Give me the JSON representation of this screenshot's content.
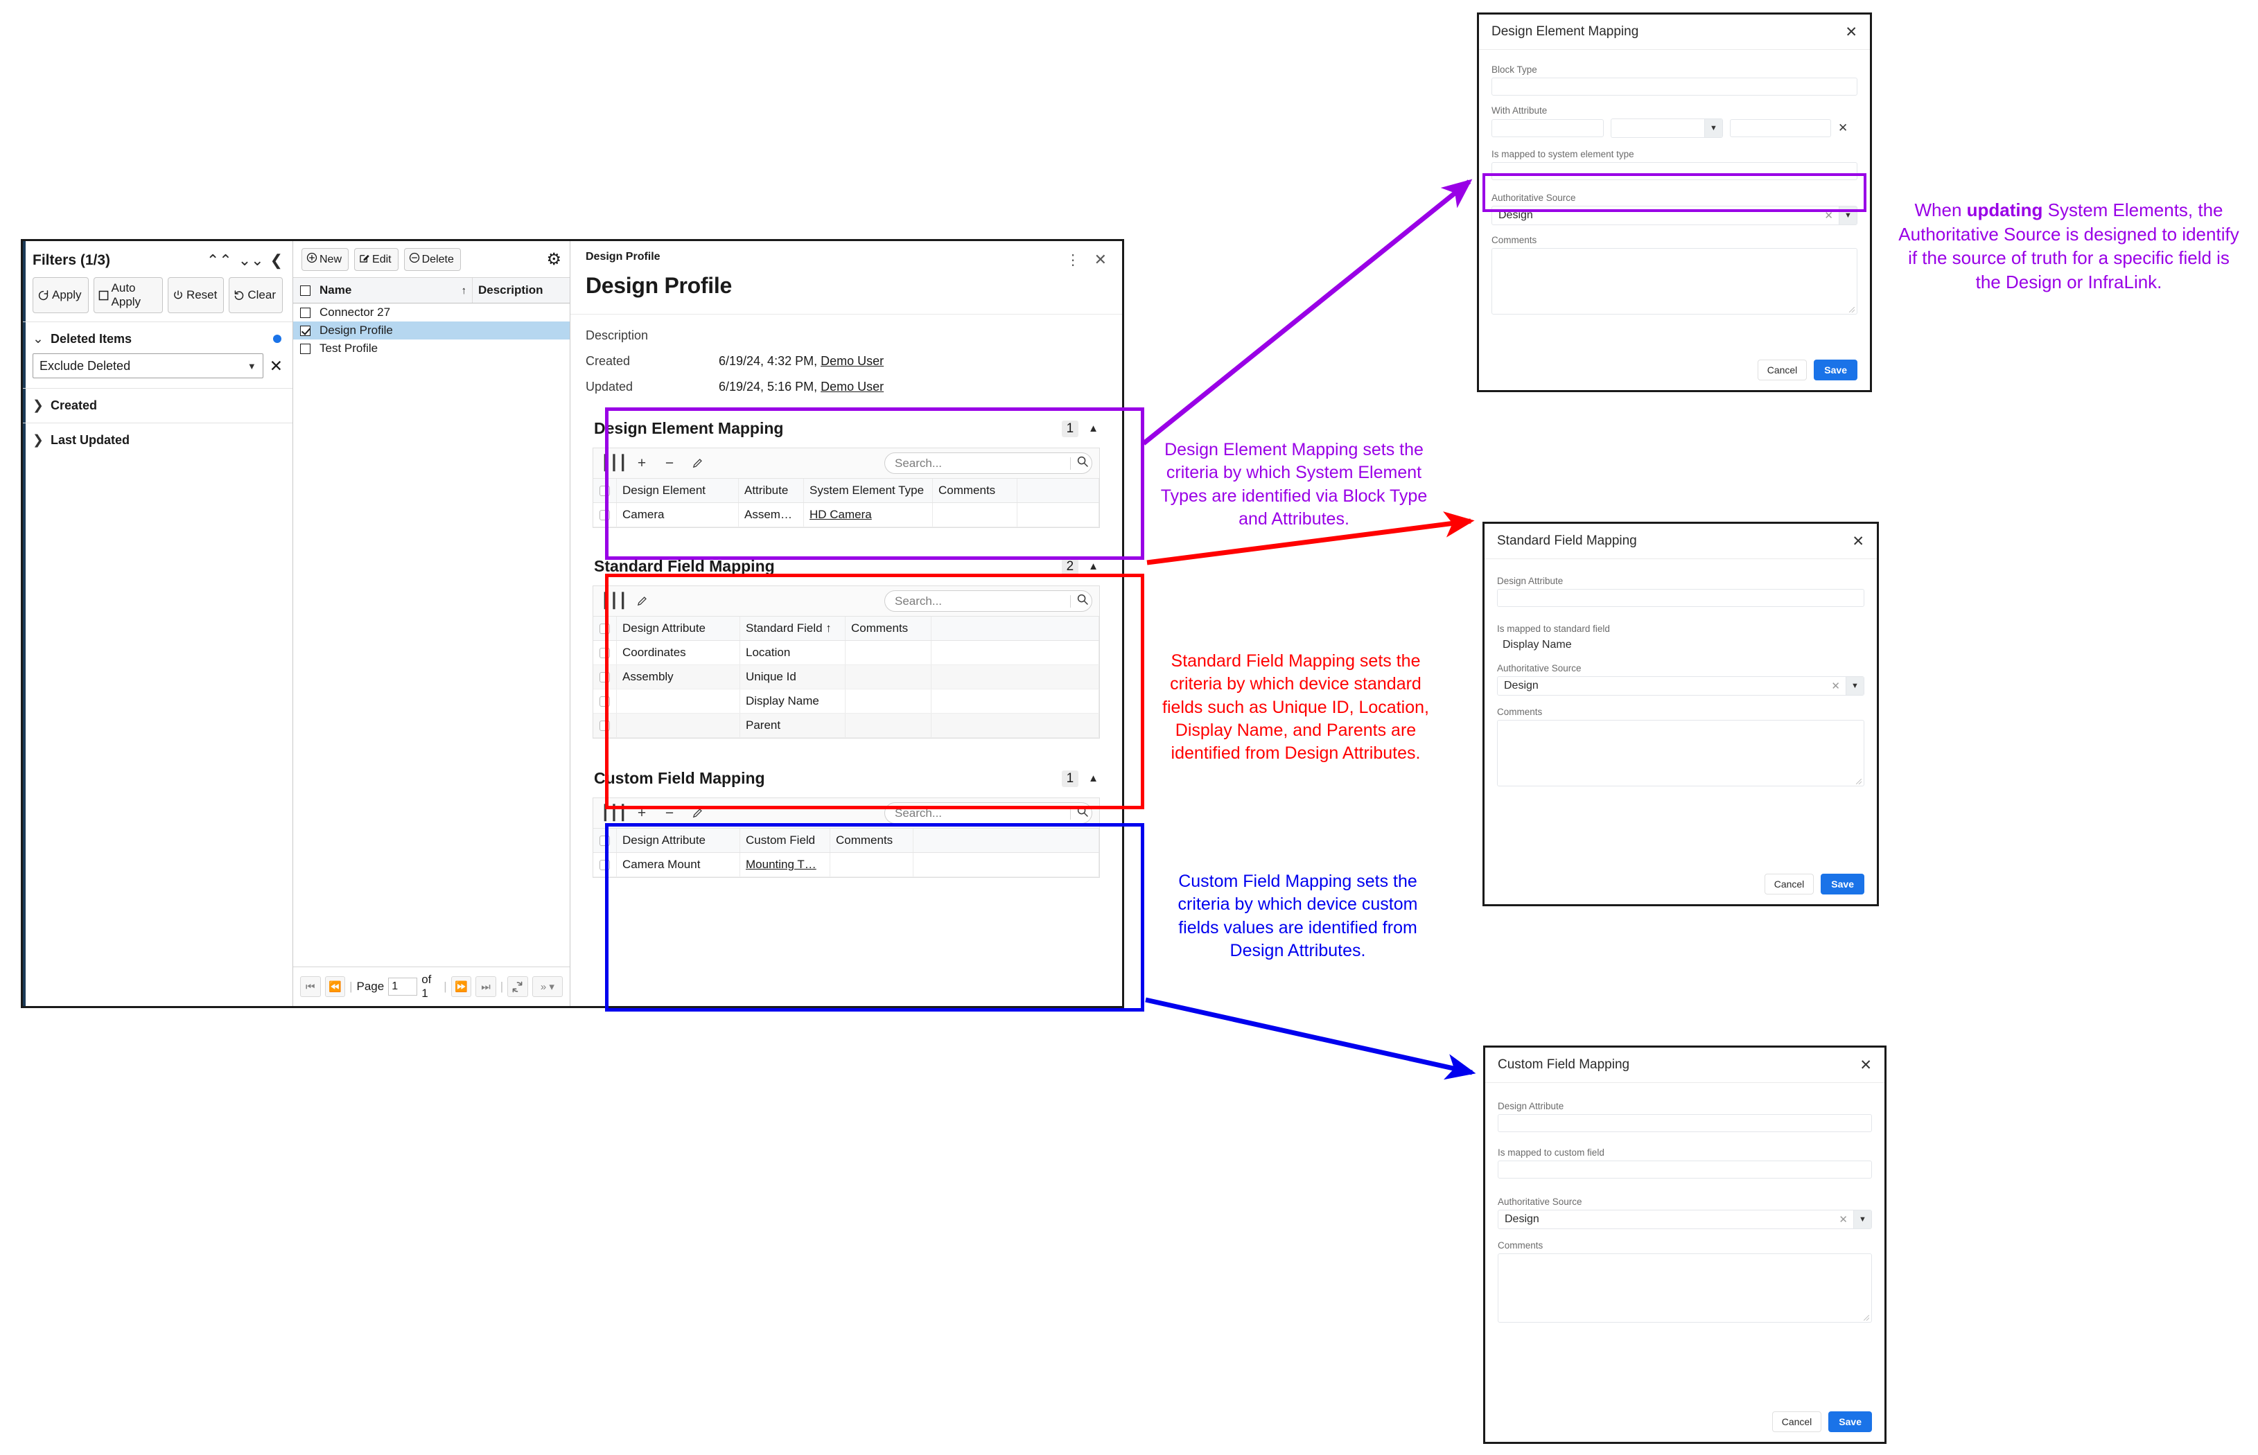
{
  "filters": {
    "title": "Filters (1/3)",
    "collapse_all_icon": "chevrons-up-icon",
    "expand_all_icon": "chevrons-down-icon",
    "hide_panel_icon": "chevron-left-icon",
    "buttons": [
      {
        "label": "Apply",
        "icon": "refresh-icon"
      },
      {
        "label": "Auto Apply",
        "icon": "checkbox-icon"
      },
      {
        "label": "Reset",
        "icon": "power-icon"
      },
      {
        "label": "Clear",
        "icon": "undo-icon"
      }
    ],
    "sections": [
      {
        "label": "Deleted Items",
        "expanded": true,
        "has_dot": true,
        "value": "Exclude Deleted"
      },
      {
        "label": "Created",
        "expanded": false,
        "has_dot": false
      },
      {
        "label": "Last Updated",
        "expanded": false,
        "has_dot": false
      }
    ]
  },
  "list": {
    "toolbar": [
      {
        "label": "New",
        "icon": "plus-circle-icon"
      },
      {
        "label": "Edit",
        "icon": "pencil-square-icon"
      },
      {
        "label": "Delete",
        "icon": "minus-circle-icon"
      }
    ],
    "settings_icon": "gear-icon",
    "columns": [
      "Name",
      "Description"
    ],
    "sort_arrow": "↑",
    "rows": [
      {
        "name": "Connector 27",
        "description": "",
        "checked": false,
        "selected": false
      },
      {
        "name": "Design Profile",
        "description": "",
        "checked": true,
        "selected": true
      },
      {
        "name": "Test Profile",
        "description": "",
        "checked": false,
        "selected": false
      }
    ],
    "pager": {
      "first_icon": "first-page-icon",
      "prev_icon": "prev-page-icon",
      "page_label": "Page",
      "page_value": "1",
      "of_label": "of 1",
      "next_icon": "next-page-icon",
      "last_icon": "last-page-icon",
      "refresh_icon": "refresh-icon",
      "more_icon": "double-chevron-right-icon"
    }
  },
  "detail": {
    "breadcrumb": "Design Profile",
    "menu_icon": "more-vertical-icon",
    "close_icon": "close-icon",
    "title": "Design Profile",
    "meta": [
      {
        "key": "Description",
        "value": "",
        "user": ""
      },
      {
        "key": "Created",
        "value": "6/19/24, 4:32 PM,",
        "user": "Demo User"
      },
      {
        "key": "Updated",
        "value": "6/19/24, 5:16 PM,",
        "user": "Demo User"
      }
    ]
  },
  "sections": [
    {
      "id": "design-element-mapping",
      "title": "Design Element Mapping",
      "count": "1",
      "collapse_icon": "caret-up-icon",
      "tools": [
        "columns-icon",
        "plus-icon",
        "minus-icon",
        "pencil-icon"
      ],
      "search_placeholder": "Search...",
      "search_icon": "search-icon",
      "columns": [
        "Design Element",
        "Attribute",
        "System Element Type",
        "Comments"
      ],
      "rows": [
        {
          "cells": [
            "Camera",
            "Assem…",
            "HD Camera",
            ""
          ],
          "link_index": 2
        }
      ],
      "outline_color": "#9900e6"
    },
    {
      "id": "standard-field-mapping",
      "title": "Standard Field Mapping",
      "count": "2",
      "collapse_icon": "caret-up-icon",
      "tools": [
        "columns-icon",
        "pencil-icon"
      ],
      "search_placeholder": "Search...",
      "search_icon": "search-icon",
      "columns": [
        "Design Attribute",
        "Standard Field ↑",
        "Comments"
      ],
      "rows": [
        {
          "cells": [
            "Coordinates",
            "Location",
            ""
          ],
          "link_index": -1
        },
        {
          "cells": [
            "Assembly",
            "Unique Id",
            ""
          ],
          "link_index": -1
        },
        {
          "cells": [
            "",
            "Display Name",
            ""
          ],
          "link_index": -1
        },
        {
          "cells": [
            "",
            "Parent",
            ""
          ],
          "link_index": -1
        }
      ],
      "outline_color": "#ff0000"
    },
    {
      "id": "custom-field-mapping",
      "title": "Custom Field Mapping",
      "count": "1",
      "collapse_icon": "caret-up-icon",
      "tools": [
        "columns-icon",
        "plus-icon",
        "minus-icon",
        "pencil-icon"
      ],
      "search_placeholder": "Search...",
      "search_icon": "search-icon",
      "columns": [
        "Design Attribute",
        "Custom Field",
        "Comments"
      ],
      "rows": [
        {
          "cells": [
            "Camera Mount",
            "Mounting T…",
            ""
          ],
          "link_index": 1
        }
      ],
      "outline_color": "#0000ee"
    }
  ],
  "dialogs": {
    "design_element": {
      "title": "Design Element Mapping",
      "close_icon": "close-icon",
      "block_type_label": "Block Type",
      "block_type_value": "",
      "with_attribute_label": "With Attribute",
      "with_attribute_value_1": "",
      "with_attribute_operator": "",
      "with_attribute_value_2": "",
      "remove_icon": "close-icon",
      "mapped_label": "Is mapped to system element type",
      "mapped_value": "",
      "auth_label": "Authoritative Source",
      "auth_value": "Design",
      "clear_icon": "close-icon",
      "dropdown_icon": "caret-down-icon",
      "comments_label": "Comments",
      "comments_value": "",
      "cancel_label": "Cancel",
      "save_label": "Save"
    },
    "standard_field": {
      "title": "Standard Field Mapping",
      "close_icon": "close-icon",
      "design_attribute_label": "Design Attribute",
      "design_attribute_value": "",
      "mapped_label": "Is mapped to standard field",
      "mapped_value": "Display Name",
      "auth_label": "Authoritative Source",
      "auth_value": "Design",
      "clear_icon": "close-icon",
      "dropdown_icon": "caret-down-icon",
      "comments_label": "Comments",
      "comments_value": "",
      "cancel_label": "Cancel",
      "save_label": "Save"
    },
    "custom_field": {
      "title": "Custom Field Mapping",
      "close_icon": "close-icon",
      "design_attribute_label": "Design Attribute",
      "design_attribute_value": "",
      "mapped_label": "Is mapped to custom field",
      "mapped_value": "",
      "auth_label": "Authoritative Source",
      "auth_value": "Design",
      "clear_icon": "close-icon",
      "dropdown_icon": "caret-down-icon",
      "comments_label": "Comments",
      "comments_value": "",
      "cancel_label": "Cancel",
      "save_label": "Save"
    }
  },
  "annotations": {
    "authoritative_source": {
      "prefix": "When ",
      "bold": "updating",
      "suffix": " System Elements, the Authoritative Source is designed to identify if the source of truth for a specific field is the Design or InfraLink.",
      "color": "#9900e6"
    },
    "design_element": {
      "text": "Design Element Mapping sets the criteria by which System Element Types are identified via Block Type and Attributes.",
      "color": "#9900e6"
    },
    "standard_field": {
      "text": "Standard Field Mapping sets the criteria by which device standard fields such as Unique ID, Location, Display Name, and Parents are identified from Design Attributes.",
      "color": "#ff0000"
    },
    "custom_field": {
      "text": "Custom Field Mapping sets the criteria by which device custom fields values are identified from Design Attributes.",
      "color": "#0000ee"
    }
  },
  "colors": {
    "accent_blue": "#1a73e8",
    "purple": "#9900e6",
    "red": "#ff0000",
    "blue": "#0000ee",
    "selection": "#b6d7f0"
  }
}
